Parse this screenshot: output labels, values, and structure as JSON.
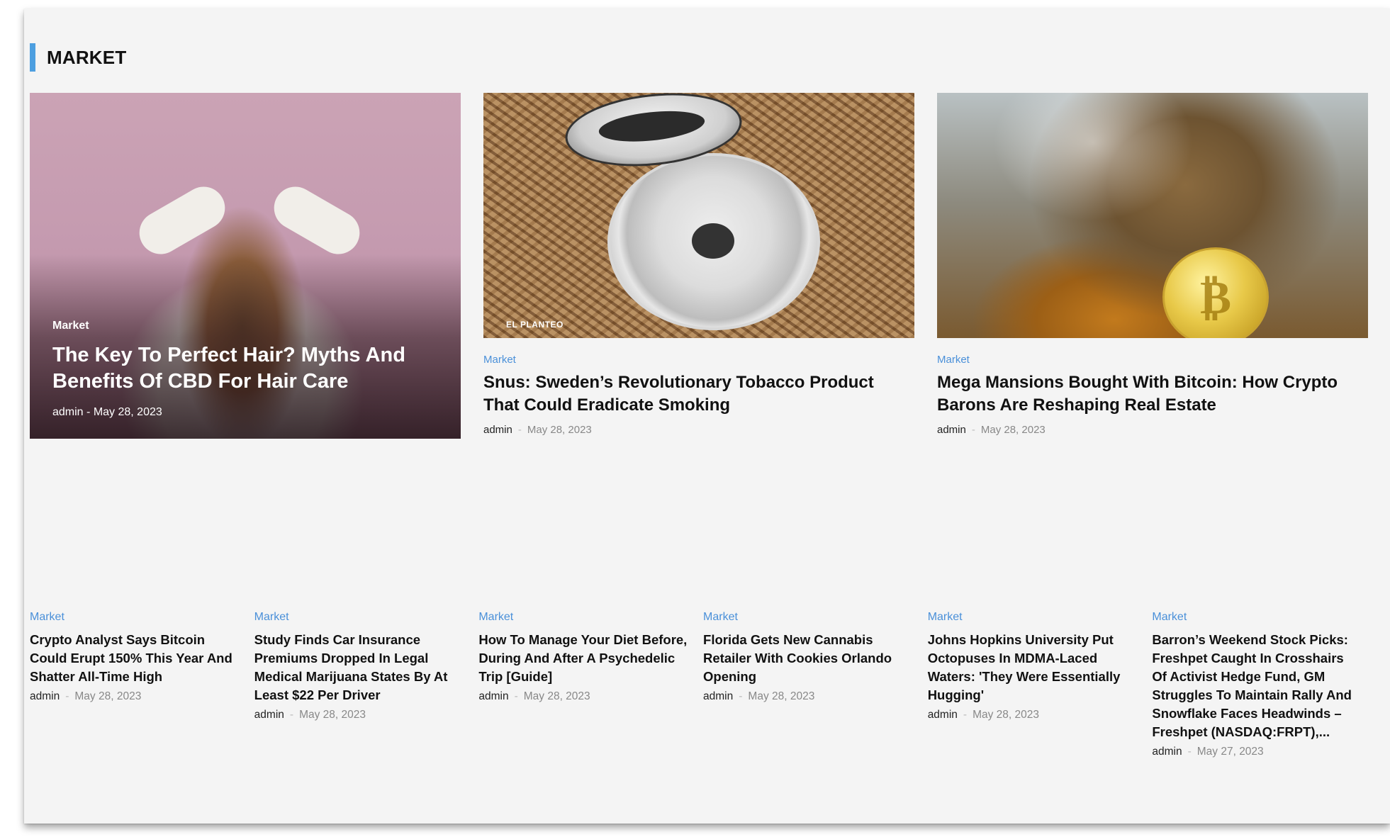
{
  "section": {
    "title": "MARKET"
  },
  "featured": [
    {
      "category": "Market",
      "title": "The Key To Perfect Hair? Myths And Benefits Of CBD For Hair Care",
      "author": "admin",
      "date": "May 28, 2023"
    },
    {
      "category": "Market",
      "title": "Snus: Sweden’s Revolutionary Tobacco Product That Could Eradicate Smoking",
      "author": "admin",
      "date": "May 28, 2023",
      "image_caption": "EL PLANTEO"
    },
    {
      "category": "Market",
      "title": "Mega Mansions Bought With Bitcoin: How Crypto Barons Are Reshaping Real Estate",
      "author": "admin",
      "date": "May 28, 2023"
    }
  ],
  "list": [
    {
      "category": "Market",
      "title": "Crypto Analyst Says Bitcoin Could Erupt 150% This Year And Shatter All-Time High",
      "author": "admin",
      "date": "May 28, 2023"
    },
    {
      "category": "Market",
      "title": "Study Finds Car Insurance Premiums Dropped In Legal Medical Marijuana States By At Least $22 Per Driver",
      "author": "admin",
      "date": "May 28, 2023"
    },
    {
      "category": "Market",
      "title": "How To Manage Your Diet Before, During And After A Psychedelic Trip [Guide]",
      "author": "admin",
      "date": "May 28, 2023"
    },
    {
      "category": "Market",
      "title": "Florida Gets New Cannabis Retailer With Cookies Orlando Opening",
      "author": "admin",
      "date": "May 28, 2023"
    },
    {
      "category": "Market",
      "title": "Johns Hopkins University Put Octopuses In MDMA-Laced Waters: 'They Were Essentially Hugging'",
      "author": "admin",
      "date": "May 28, 2023"
    },
    {
      "category": "Market",
      "title": "Barron’s Weekend Stock Picks: Freshpet Caught In Crosshairs Of Activist Hedge Fund, GM Struggles To Maintain Rally And Snowflake Faces Headwinds – Freshpet (NASDAQ:FRPT),...",
      "author": "admin",
      "date": "May 27, 2023"
    }
  ],
  "colors": {
    "accent": "#4d9fe0",
    "category": "#4a90d9",
    "background": "#f4f4f4"
  }
}
